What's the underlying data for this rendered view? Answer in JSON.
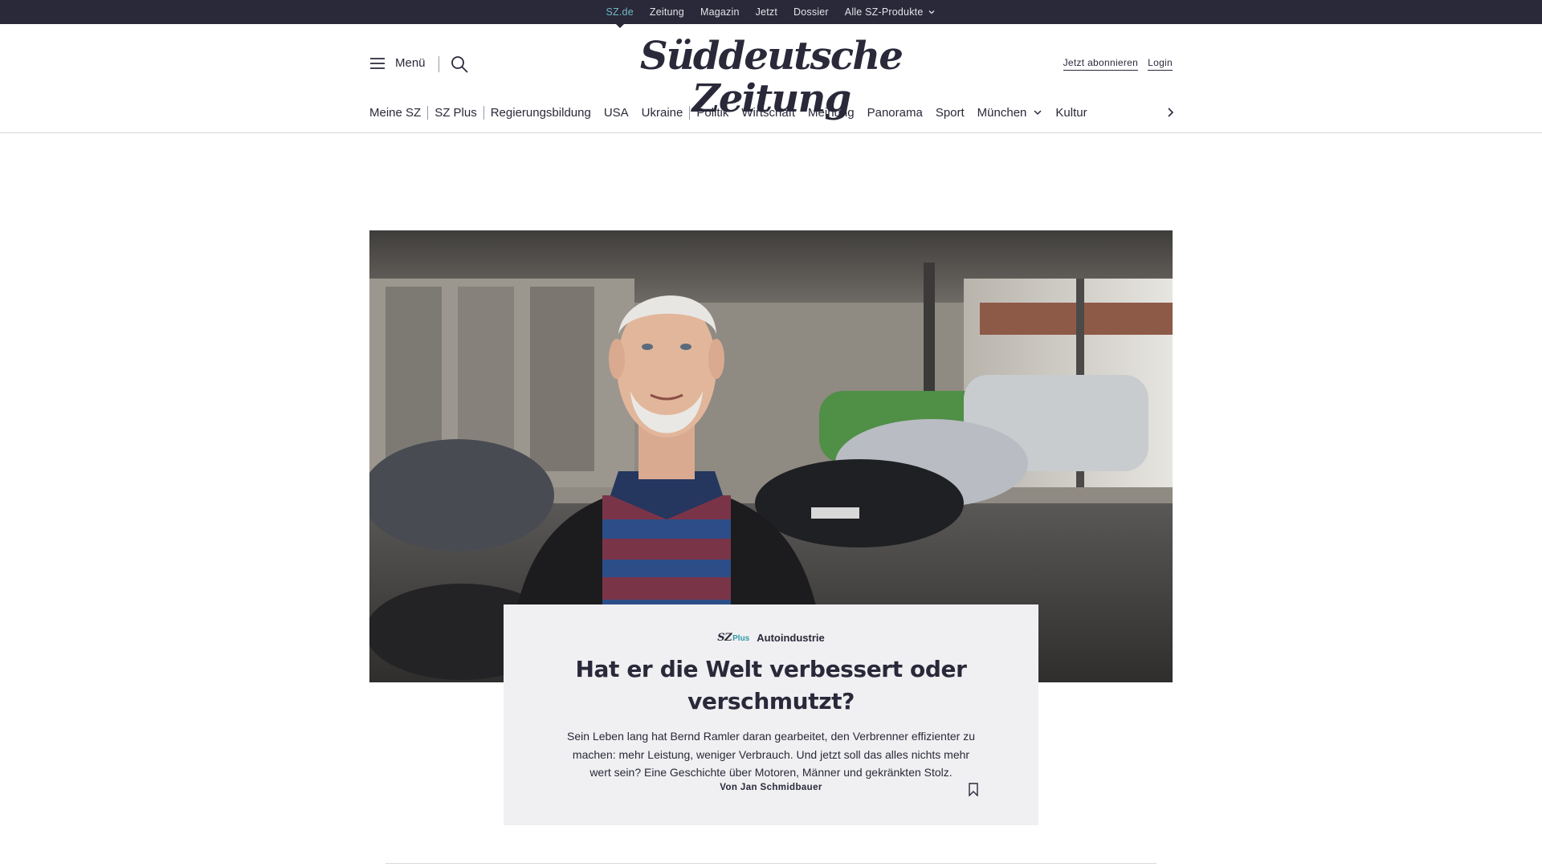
{
  "topbar": {
    "items": [
      {
        "label": "SZ.de",
        "active": true
      },
      {
        "label": "Zeitung"
      },
      {
        "label": "Magazin"
      },
      {
        "label": "Jetzt"
      },
      {
        "label": "Dossier"
      },
      {
        "label": "Alle SZ-Produkte",
        "has_dropdown": true
      }
    ]
  },
  "header": {
    "menu_label": "Menü",
    "logo_text": "Süddeutsche Zeitung",
    "subscribe_label": "Jetzt abonnieren",
    "login_label": "Login"
  },
  "nav": {
    "items": [
      {
        "label": "Meine SZ"
      },
      {
        "label": "SZ Plus"
      },
      {
        "label": "Regierungsbildung"
      },
      {
        "label": "USA"
      },
      {
        "label": "Ukraine"
      },
      {
        "label": "Politik"
      },
      {
        "label": "Wirtschaft"
      },
      {
        "label": "Meinung"
      },
      {
        "label": "Panorama"
      },
      {
        "label": "Sport"
      },
      {
        "label": "München",
        "has_dropdown": true
      },
      {
        "label": "Kultur"
      }
    ]
  },
  "teaser": {
    "plus_logo_sz": "SZ",
    "plus_logo_plus": "Plus",
    "kicker": "Autoindustrie",
    "headline": "Hat er die Welt verbessert oder verschmutzt?",
    "summary": "Sein Leben lang hat Bernd Ramler daran gearbeitet, den Verbrenner effizienter zu machen: mehr Leistung, weniger Verbrauch. Und jetzt soll das alles nichts mehr wert sein? Eine Geschichte über Motoren, Männer und gekränkten Stolz.",
    "byline": "Von Jan Schmidbauer"
  },
  "colors": {
    "topbar_bg": "#29293a",
    "active_link": "#71b8c4",
    "plus_accent": "#2f9aa5",
    "teaser_bg": "#f0f0f2"
  }
}
